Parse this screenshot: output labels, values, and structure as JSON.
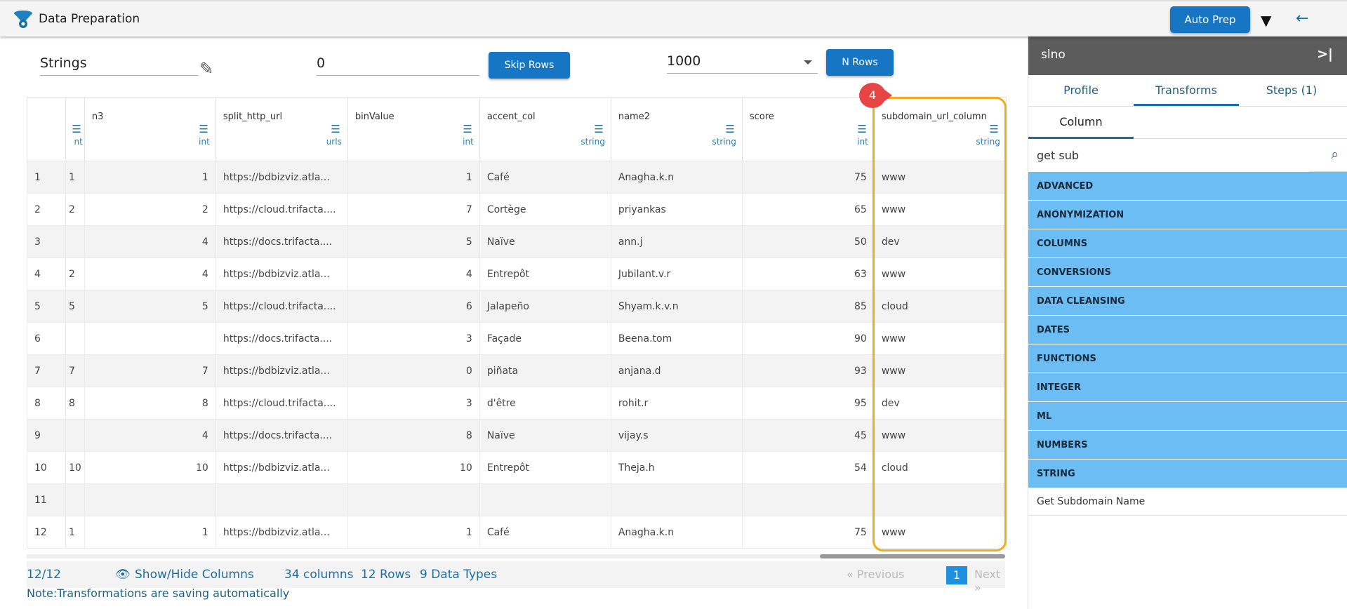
{
  "header": {
    "title": "Data Preparation",
    "auto_prep": "Auto Prep"
  },
  "toolbar": {
    "name_value": "Strings",
    "skip_value": "0",
    "skip_label": "Skip Rows",
    "nrows_value": "1000",
    "nrows_label": "N Rows"
  },
  "table": {
    "columns": [
      {
        "name": "",
        "type": "nt"
      },
      {
        "name": "n3",
        "type": "int"
      },
      {
        "name": "split_http_url",
        "type": "urls"
      },
      {
        "name": "binValue",
        "type": "int"
      },
      {
        "name": "accent_col",
        "type": "string"
      },
      {
        "name": "name2",
        "type": "string"
      },
      {
        "name": "score",
        "type": "int"
      },
      {
        "name": "subdomain_url_column",
        "type": "string"
      }
    ],
    "rows": [
      [
        "1",
        "1",
        "1",
        "https://bdbizviz.atla...",
        "1",
        "Café",
        "Anagha.k.n",
        "75",
        "www"
      ],
      [
        "2",
        "2",
        "2",
        "https://cloud.trifacta....",
        "7",
        "Cortège",
        "priyankas",
        "65",
        "www"
      ],
      [
        "3",
        "",
        "4",
        "https://docs.trifacta....",
        "5",
        "Naïve",
        "ann.j",
        "50",
        "dev"
      ],
      [
        "4",
        "2",
        "4",
        "https://bdbizviz.atla...",
        "4",
        "Entrepôt",
        "Jubilant.v.r",
        "63",
        "www"
      ],
      [
        "5",
        "5",
        "5",
        "https://cloud.trifacta....",
        "6",
        "Jalapeño",
        "Shyam.k.v.n",
        "85",
        "cloud"
      ],
      [
        "6",
        "",
        "",
        "https://docs.trifacta....",
        "3",
        "Façade",
        "Beena.tom",
        "90",
        "www"
      ],
      [
        "7",
        "7",
        "7",
        "https://bdbizviz.atla...",
        "0",
        "piñata",
        "anjana.d",
        "93",
        "www"
      ],
      [
        "8",
        "8",
        "8",
        "https://cloud.trifacta....",
        "3",
        "d'être",
        "rohit.r",
        "95",
        "dev"
      ],
      [
        "9",
        "",
        "4",
        "https://docs.trifacta....",
        "8",
        "Naïve",
        "vijay.s",
        "45",
        "www"
      ],
      [
        "10",
        "10",
        "10",
        "https://bdbizviz.atla...",
        "10",
        "Entrepôt",
        "Theja.h",
        "54",
        "cloud"
      ],
      [
        "11",
        "",
        "",
        "",
        "",
        "",
        "",
        "",
        ""
      ],
      [
        "12",
        "1",
        "1",
        "https://bdbizviz.atla...",
        "1",
        "Café",
        "Anagha.k.n",
        "75",
        "www"
      ]
    ]
  },
  "callout": {
    "number": "4",
    "color": "#f0ac1a"
  },
  "footer": {
    "count": "12/12",
    "show_hide": "Show/Hide Columns",
    "columns": "34 columns",
    "rows": "12 Rows",
    "types": "9 Data Types",
    "previous": "Previous",
    "page": "1",
    "next": "Next",
    "note": "Note:Transformations are saving automatically"
  },
  "panel": {
    "title": "slno",
    "tabs": [
      "Profile",
      "Transforms",
      "Steps (1)"
    ],
    "subtab": "Column",
    "search_value": "get sub",
    "categories": [
      "ADVANCED",
      "ANONYMIZATION",
      "COLUMNS",
      "CONVERSIONS",
      "DATA CLEANSING",
      "DATES",
      "FUNCTIONS",
      "INTEGER",
      "ML",
      "NUMBERS",
      "STRING"
    ],
    "result": "Get Subdomain Name"
  }
}
